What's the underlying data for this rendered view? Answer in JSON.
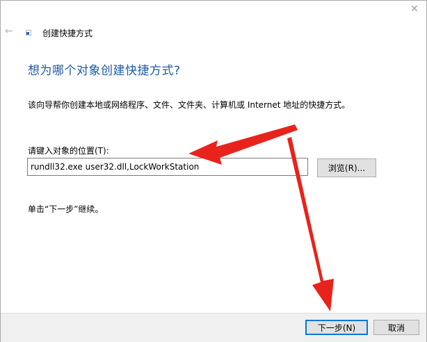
{
  "window": {
    "close_glyph": "✕"
  },
  "header": {
    "back_glyph": "←",
    "title": "创建快捷方式"
  },
  "main": {
    "heading": "想为哪个对象创建快捷方式?",
    "description": "该向导帮你创建本地或网络程序、文件、文件夹、计算机或 Internet 地址的快捷方式。",
    "location_label": "请键入对象的位置(T):",
    "location_value": "rundll32.exe user32.dll,LockWorkStation",
    "browse_label": "浏览(R)...",
    "hint": "单击“下一步”继续。"
  },
  "footer": {
    "next_label": "下一步(N)",
    "cancel_label": "取消"
  },
  "colors": {
    "heading": "#1d5ba6",
    "arrow": "#e8231b",
    "focus": "#0078d7"
  }
}
